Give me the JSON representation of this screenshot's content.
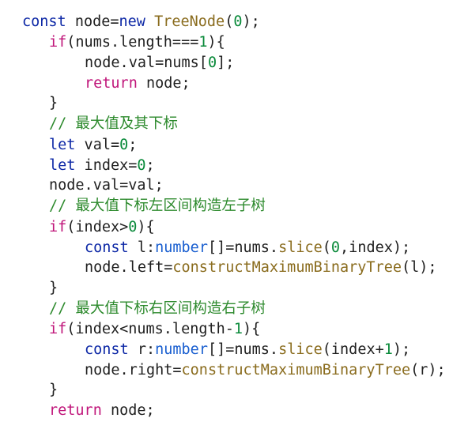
{
  "code": {
    "lines": [
      [
        {
          "t": "const",
          "c": "kw2"
        },
        {
          "t": " node=",
          "c": "plain"
        },
        {
          "t": "new",
          "c": "kw2"
        },
        {
          "t": " ",
          "c": "plain"
        },
        {
          "t": "TreeNode",
          "c": "fn"
        },
        {
          "t": "(",
          "c": "plain"
        },
        {
          "t": "0",
          "c": "num"
        },
        {
          "t": ");",
          "c": "plain"
        }
      ],
      [
        {
          "t": "if",
          "c": "kw"
        },
        {
          "t": "(nums.length===",
          "c": "plain"
        },
        {
          "t": "1",
          "c": "num"
        },
        {
          "t": "){",
          "c": "plain"
        }
      ],
      [
        {
          "t": "node.val=nums[",
          "c": "plain"
        },
        {
          "t": "0",
          "c": "num"
        },
        {
          "t": "];",
          "c": "plain"
        }
      ],
      [
        {
          "t": "return",
          "c": "kw"
        },
        {
          "t": " node;",
          "c": "plain"
        }
      ],
      [
        {
          "t": "}",
          "c": "plain"
        }
      ],
      [
        {
          "t": "// 最大值及其下标",
          "c": "cm"
        }
      ],
      [
        {
          "t": "let",
          "c": "kw2"
        },
        {
          "t": " val=",
          "c": "plain"
        },
        {
          "t": "0",
          "c": "num"
        },
        {
          "t": ";",
          "c": "plain"
        }
      ],
      [
        {
          "t": "let",
          "c": "kw2"
        },
        {
          "t": " index=",
          "c": "plain"
        },
        {
          "t": "0",
          "c": "num"
        },
        {
          "t": ";",
          "c": "plain"
        }
      ],
      [
        {
          "t": "node.val=val;",
          "c": "plain"
        }
      ],
      [
        {
          "t": "// 最大值下标左区间构造左子树",
          "c": "cm"
        }
      ],
      [
        {
          "t": "if",
          "c": "kw"
        },
        {
          "t": "(index>",
          "c": "plain"
        },
        {
          "t": "0",
          "c": "num"
        },
        {
          "t": "){",
          "c": "plain"
        }
      ],
      [
        {
          "t": "const",
          "c": "kw2"
        },
        {
          "t": " l:",
          "c": "plain"
        },
        {
          "t": "number",
          "c": "type"
        },
        {
          "t": "[]=nums.",
          "c": "plain"
        },
        {
          "t": "slice",
          "c": "fn"
        },
        {
          "t": "(",
          "c": "plain"
        },
        {
          "t": "0",
          "c": "num"
        },
        {
          "t": ",index);",
          "c": "plain"
        }
      ],
      [
        {
          "t": "node.left=",
          "c": "plain"
        },
        {
          "t": "constructMaximumBinaryTree",
          "c": "fn"
        },
        {
          "t": "(l);",
          "c": "plain"
        }
      ],
      [
        {
          "t": "}",
          "c": "plain"
        }
      ],
      [
        {
          "t": "// 最大值下标右区间构造右子树",
          "c": "cm"
        }
      ],
      [
        {
          "t": "if",
          "c": "kw"
        },
        {
          "t": "(index<nums.length-",
          "c": "plain"
        },
        {
          "t": "1",
          "c": "num"
        },
        {
          "t": "){",
          "c": "plain"
        }
      ],
      [
        {
          "t": "const",
          "c": "kw2"
        },
        {
          "t": " r:",
          "c": "plain"
        },
        {
          "t": "number",
          "c": "type"
        },
        {
          "t": "[]=nums.",
          "c": "plain"
        },
        {
          "t": "slice",
          "c": "fn"
        },
        {
          "t": "(index+",
          "c": "plain"
        },
        {
          "t": "1",
          "c": "num"
        },
        {
          "t": ");",
          "c": "plain"
        }
      ],
      [
        {
          "t": "node.right=",
          "c": "plain"
        },
        {
          "t": "constructMaximumBinaryTree",
          "c": "fn"
        },
        {
          "t": "(r);",
          "c": "plain"
        }
      ],
      [
        {
          "t": "}",
          "c": "plain"
        }
      ],
      [
        {
          "t": "return",
          "c": "kw"
        },
        {
          "t": " node;",
          "c": "plain"
        }
      ]
    ]
  },
  "colors": {
    "keyword_magenta": "#c0157a",
    "keyword_blue": "#0d28a6",
    "function": "#8a6c1e",
    "number": "#0a8a3a",
    "type": "#1a5fd0",
    "comment": "#2d8a2d",
    "text": "#1f1f1f",
    "background": "#ffffff"
  }
}
